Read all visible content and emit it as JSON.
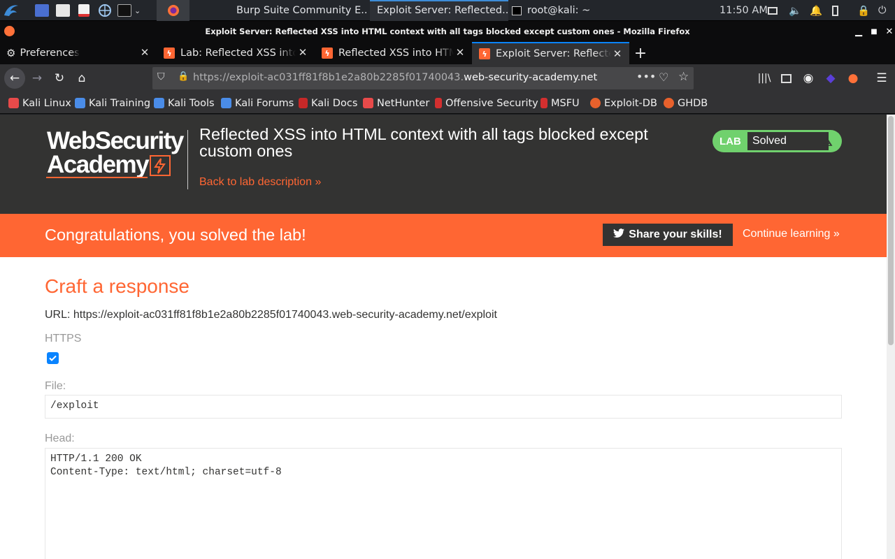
{
  "taskbar": {
    "windows": [
      {
        "label": "Burp Suite Community E..."
      },
      {
        "label": "Exploit Server: Reflected..."
      },
      {
        "label": "root@kali: ~"
      }
    ],
    "clock": "11:50 AM"
  },
  "browser": {
    "window_title": "Exploit Server: Reflected XSS into HTML context with all tags blocked except custom ones - Mozilla Firefox",
    "tabs": [
      {
        "label": "Preferences"
      },
      {
        "label": "Lab: Reflected XSS into HTML context"
      },
      {
        "label": "Reflected XSS into HTML context"
      },
      {
        "label": "Exploit Server: Reflected XSS"
      }
    ],
    "url_prefix": "https://exploit-ac031ff81f8b1e2a80b2285f01740043.",
    "url_host": "web-security-academy.net",
    "bookmarks": [
      "Kali Linux",
      "Kali Training",
      "Kali Tools",
      "Kali Forums",
      "Kali Docs",
      "NetHunter",
      "Offensive Security",
      "MSFU",
      "Exploit-DB",
      "GHDB"
    ]
  },
  "lab": {
    "logo_line1": "WebSecurity",
    "logo_line2": "Academy",
    "title": "Reflected XSS into HTML context with all tags blocked except custom ones",
    "back_link": "Back to lab description",
    "badge": "LAB",
    "status": "Solved",
    "congrats": "Congratulations, you solved the lab!",
    "share_button": "Share your skills!",
    "continue_link": "Continue learning"
  },
  "form": {
    "title": "Craft a response",
    "url_line": "URL: https://exploit-ac031ff81f8b1e2a80b2285f01740043.web-security-academy.net/exploit",
    "https_label": "HTTPS",
    "https_checked": true,
    "file_label": "File:",
    "file_value": "/exploit",
    "head_label": "Head:",
    "head_line1": "HTTP/1.1 200 OK",
    "head_line2": "Content-Type: text/html; charset=utf-8"
  },
  "colors": {
    "accent": "#ff6633",
    "solved": "#70d16d",
    "header_bg": "#333332"
  }
}
